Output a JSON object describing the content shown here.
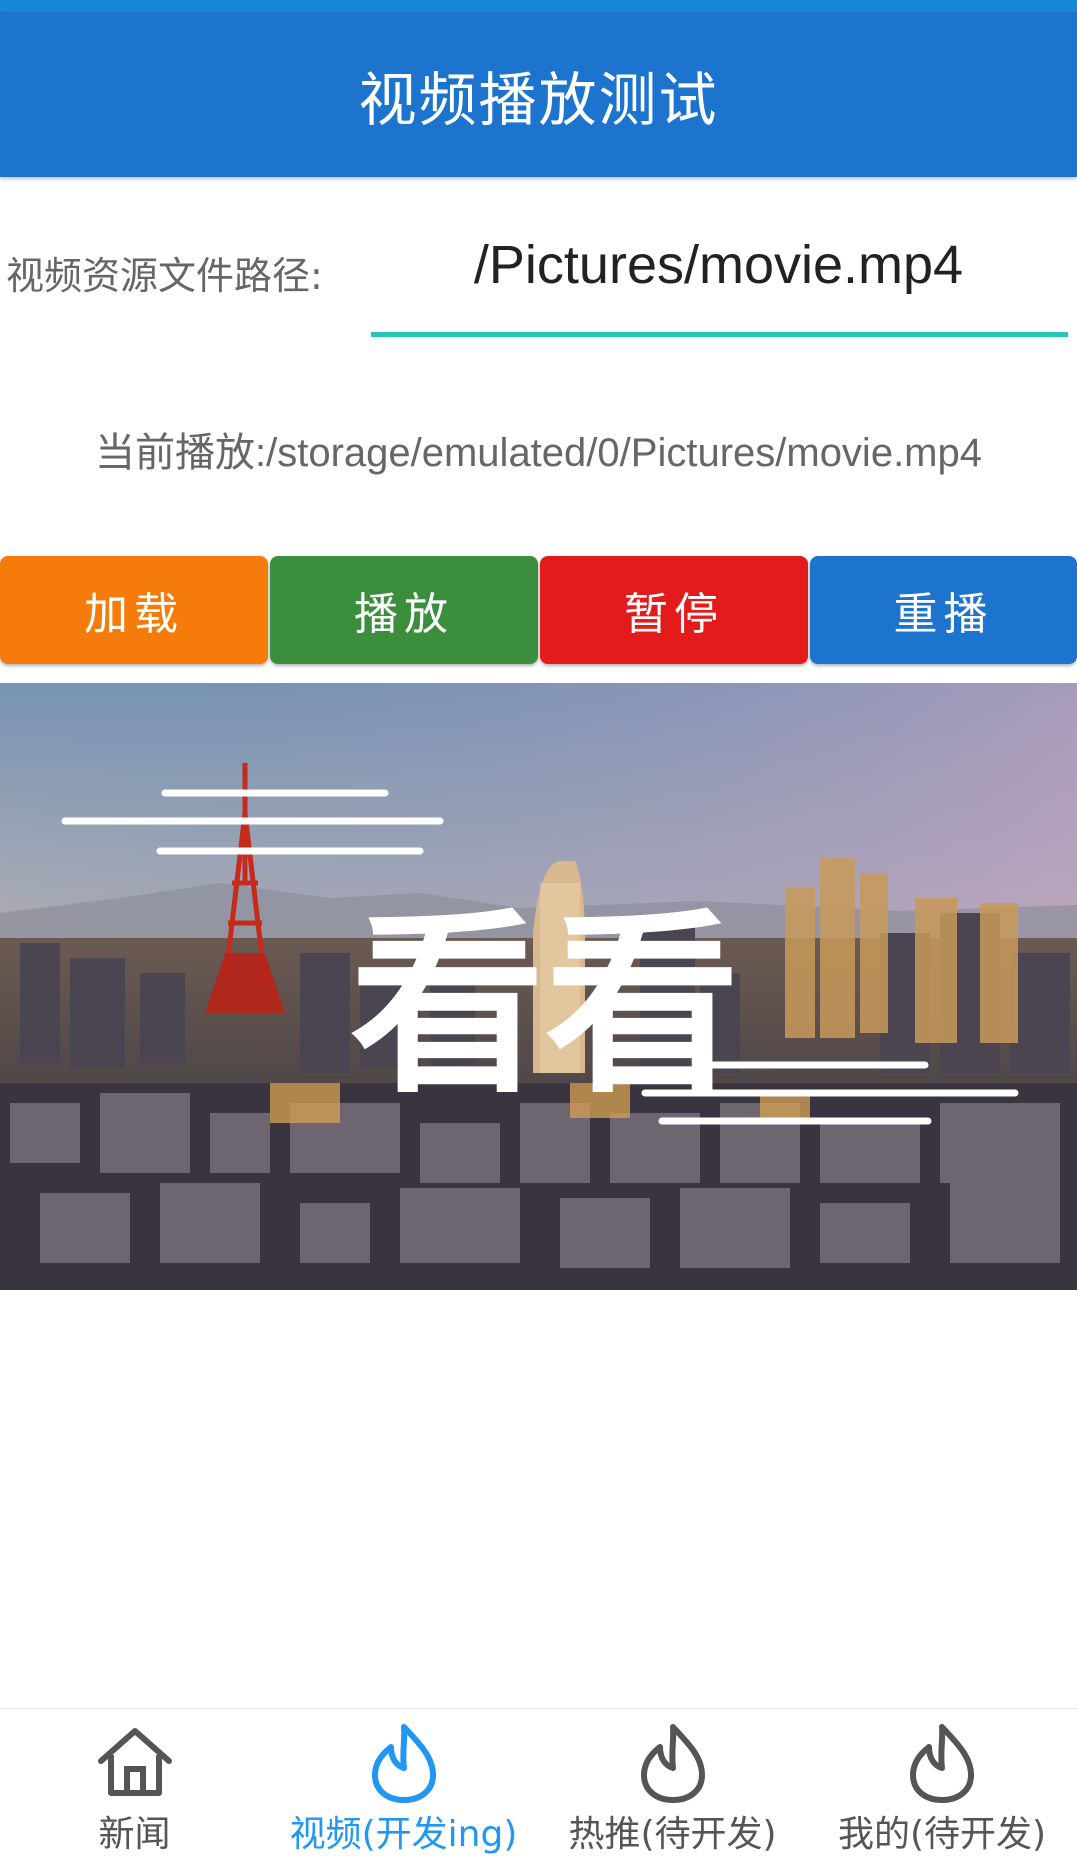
{
  "app": {
    "title": "视频播放测试"
  },
  "path": {
    "label": "视频资源文件路径:",
    "value": "/Pictures/movie.mp4"
  },
  "current": {
    "text": "当前播放:/storage/emulated/0/Pictures/movie.mp4"
  },
  "buttons": [
    {
      "label": "加载",
      "color": "#f57c0b"
    },
    {
      "label": "播放",
      "color": "#3a8e3c"
    },
    {
      "label": "暂停",
      "color": "#e41b1b"
    },
    {
      "label": "重播",
      "color": "#1c74cf"
    }
  ],
  "video": {
    "overlay_text": "看看"
  },
  "nav": [
    {
      "label": "新闻",
      "icon": "home-icon",
      "active": false
    },
    {
      "label": "视频(开发ing)",
      "icon": "flame-icon",
      "active": true
    },
    {
      "label": "热推(待开发)",
      "icon": "flame-icon",
      "active": false
    },
    {
      "label": "我的(待开发)",
      "icon": "flame-icon",
      "active": false
    }
  ],
  "colors": {
    "appbar": "#1c74cf",
    "accent": "#22c7b8",
    "nav_active": "#2196f3",
    "nav_inactive": "#555555"
  }
}
